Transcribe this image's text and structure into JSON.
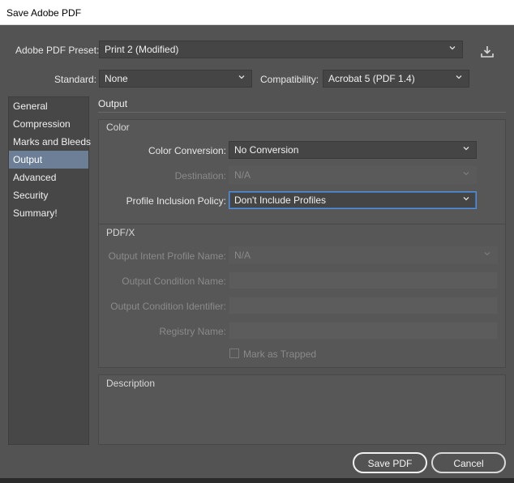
{
  "window": {
    "title": "Save Adobe PDF"
  },
  "preset": {
    "label": "Adobe PDF Preset:",
    "value": "Print 2 (Modified)"
  },
  "standard": {
    "label": "Standard:",
    "value": "None"
  },
  "compatibility": {
    "label": "Compatibility:",
    "value": "Acrobat 5 (PDF 1.4)"
  },
  "sidebar": {
    "items": [
      {
        "label": "General"
      },
      {
        "label": "Compression"
      },
      {
        "label": "Marks and Bleeds"
      },
      {
        "label": "Output"
      },
      {
        "label": "Advanced"
      },
      {
        "label": "Security"
      },
      {
        "label": "Summary!"
      }
    ],
    "active_index": 3
  },
  "section": {
    "title": "Output"
  },
  "color": {
    "title": "Color",
    "conversion": {
      "label": "Color Conversion:",
      "value": "No Conversion"
    },
    "destination": {
      "label": "Destination:",
      "value": "N/A"
    },
    "profile_policy": {
      "label": "Profile Inclusion Policy:",
      "value": "Don't Include Profiles"
    }
  },
  "pdfx": {
    "title": "PDF/X",
    "output_intent": {
      "label": "Output Intent Profile Name:",
      "value": "N/A"
    },
    "condition_name": {
      "label": "Output Condition Name:",
      "value": ""
    },
    "condition_identifier": {
      "label": "Output Condition Identifier:",
      "value": ""
    },
    "registry_name": {
      "label": "Registry Name:",
      "value": ""
    },
    "mark_as_trapped": {
      "label": "Mark as Trapped",
      "checked": false
    }
  },
  "description": {
    "title": "Description",
    "text": ""
  },
  "buttons": {
    "save": "Save PDF",
    "cancel": "Cancel"
  },
  "icons": {
    "chevron": "chevron-down-icon",
    "download": "save-preset-icon"
  },
  "colors": {
    "panel": "#535353",
    "selected": "#6c7f96",
    "focus": "#5b8fd0"
  }
}
